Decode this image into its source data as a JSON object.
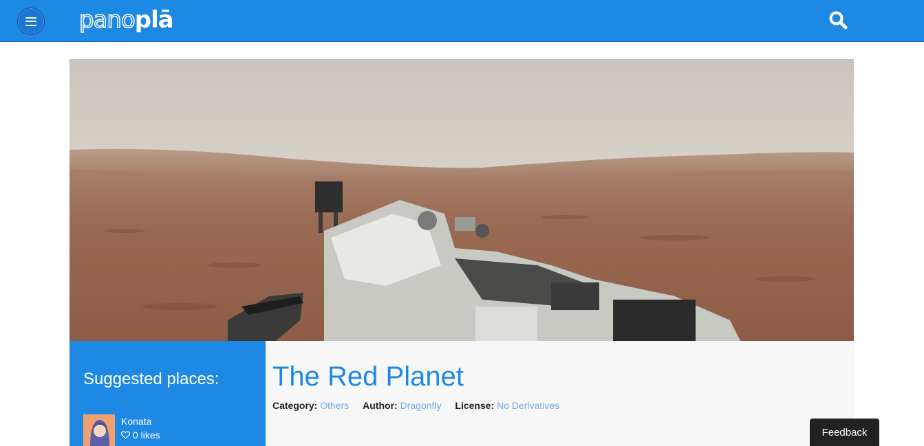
{
  "header": {
    "menu_icon": "hamburger-menu-icon",
    "logo_thin": "pano",
    "logo_bold": "plā",
    "search_icon": "search-icon",
    "bar_color": "#1e88e5"
  },
  "sidebar": {
    "title": "Suggested places:",
    "items": [
      {
        "name": "Konata",
        "likes": "0 likes",
        "like_icon": "heart-outline-icon"
      }
    ]
  },
  "place": {
    "title": "The Red Planet",
    "category_label": "Category:",
    "category_value": "Others",
    "author_label": "Author:",
    "author_value": "Dragonfly",
    "license_label": "License:",
    "license_value": "No Derivatives"
  },
  "feedback": {
    "label": "Feedback"
  },
  "colors": {
    "accent": "#1e88e5",
    "link": "#72a9e3",
    "panel": "#f7f7f7"
  }
}
